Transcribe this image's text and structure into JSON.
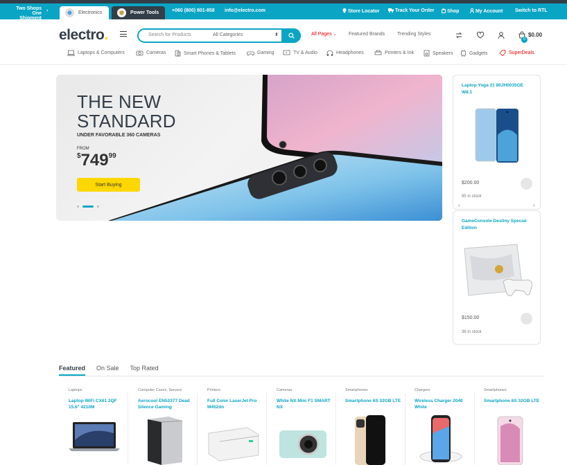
{
  "topbar": {
    "two_shops_line1": "Two Shops",
    "two_shops_line2": "One Shipment",
    "tab_electronics": "Electronics",
    "tab_power_tools": "Power Tools",
    "phone": "+060 (800) 801-858",
    "email": "info@electro.com",
    "store_locator": "Store Locator",
    "track_order": "Track Your Order",
    "shop": "Shop",
    "my_account": "My Account",
    "switch_rtl": "Switch to RTL"
  },
  "header": {
    "logo_text": "electro",
    "logo_dot": ".",
    "search_placeholder": "Search for Products",
    "search_category": "All Categories",
    "nav_all_pages": "All Pages",
    "nav_featured_brands": "Featured Brands",
    "nav_trending_styles": "Trending Styles",
    "cart_count": "0",
    "cart_total": "$0.00"
  },
  "categories": [
    {
      "label": "Laptops & Computers"
    },
    {
      "label": "Cameras"
    },
    {
      "label": "Smart Phones & Tablets"
    },
    {
      "label": "Gaming"
    },
    {
      "label": "TV & Audio"
    },
    {
      "label": "Headphones"
    },
    {
      "label": "Printers & Ink"
    },
    {
      "label": "Speakers"
    },
    {
      "label": "Gadgets"
    },
    {
      "label": "SuperDeals"
    }
  ],
  "hero": {
    "title_line1": "THE NEW",
    "title_line2": "STANDARD",
    "subtitle": "UNDER FAVORABLE 360 CAMERAS",
    "from": "FROM",
    "currency": "$",
    "price_main": "749",
    "price_cents": "99",
    "cta": "Start Buying"
  },
  "side_cards": [
    {
      "title": "Laptop Yoga 21 80JH0035GE W8.1",
      "price": "$200.00",
      "stock": "95 in stock"
    },
    {
      "title": "GameConsole Destiny Special Edition",
      "price": "$150.00",
      "stock": "36 in stock"
    }
  ],
  "tabs": {
    "featured": "Featured",
    "on_sale": "On Sale",
    "top_rated": "Top Rated"
  },
  "products": [
    {
      "category": "Laptops",
      "name": "Laptop WiFi CX61 2QF 15.6\" 4210M"
    },
    {
      "category": "Computer Cases, Servers",
      "name": "Aerocool EN52377 Dead Silence Gaming"
    },
    {
      "category": "Printers",
      "name": "Full Color LaserJet Pro M452dn"
    },
    {
      "category": "Cameras",
      "name": "White NX Mini F1 SMART NX"
    },
    {
      "category": "Smartphones",
      "name": "Smartphone 6S 32GB LTE"
    },
    {
      "category": "Chargers",
      "name": "Wireless Charger 2040 White"
    },
    {
      "category": "Smartphones",
      "name": "Smartphone 6S 32GB LTE"
    }
  ],
  "colors": {
    "accent": "#0aa5c4",
    "yellow": "#fed700",
    "dark": "#333e48",
    "red": "#ee0000"
  }
}
